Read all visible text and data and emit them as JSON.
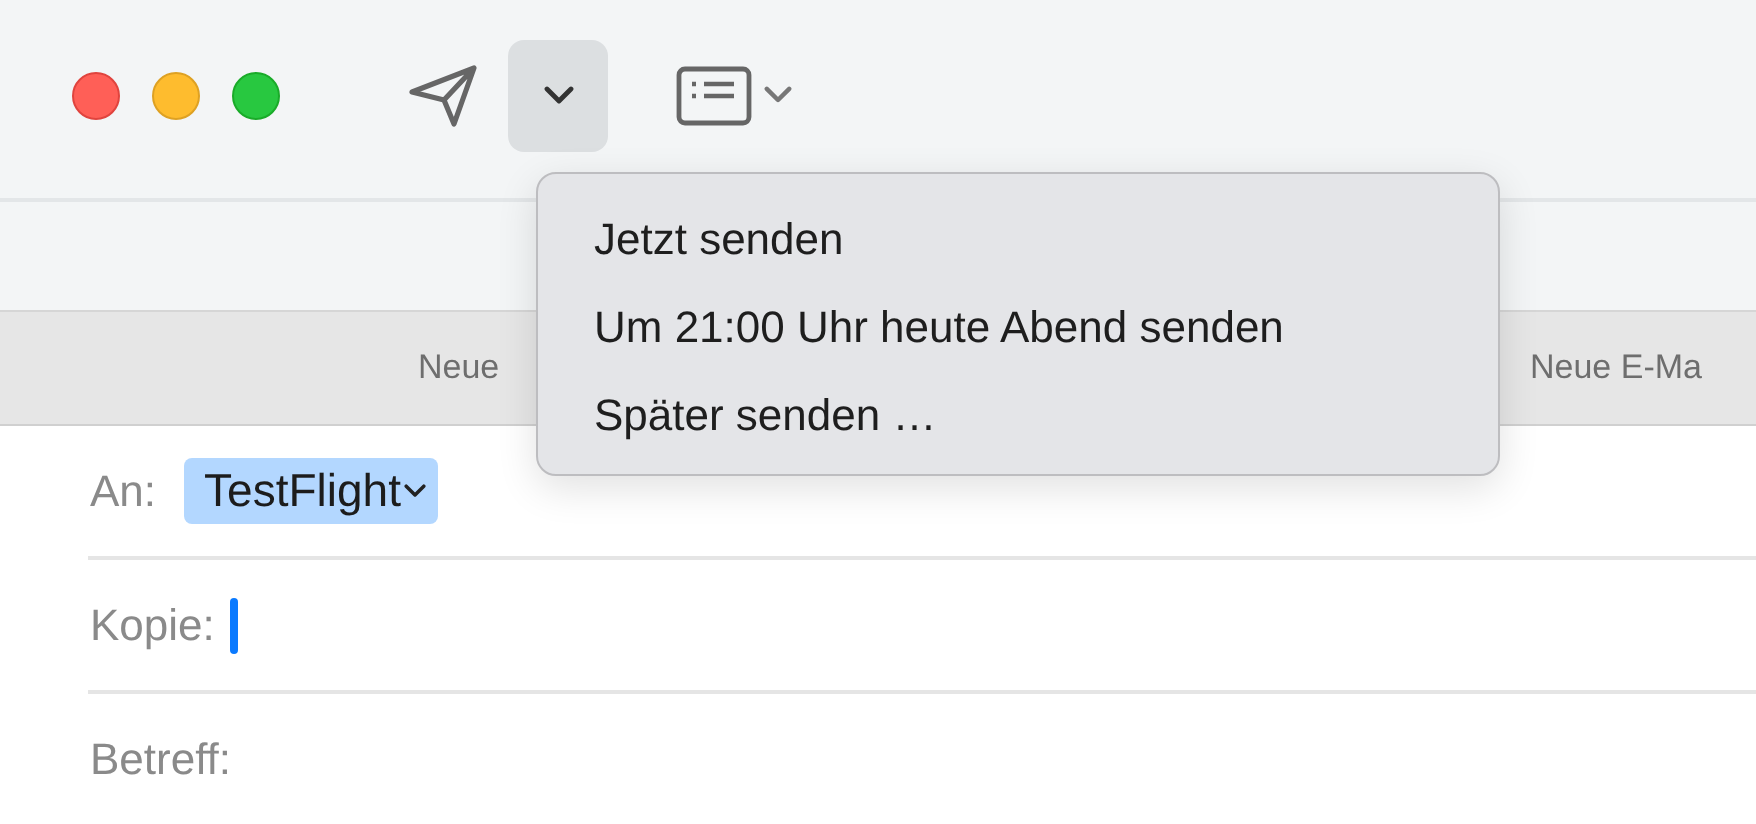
{
  "toolbar": {
    "send_options": {
      "expanded": true
    }
  },
  "tabs": [
    {
      "label": "Neue",
      "selected": false
    },
    {
      "label": "Neue E-Ma",
      "selected": false
    }
  ],
  "send_menu": {
    "items": [
      "Jetzt senden",
      "Um 21:00 Uhr heute Abend senden",
      "Später senden …"
    ]
  },
  "fields": [
    {
      "kind": "recipients",
      "label": "An:",
      "recipients": [
        "TestFlight"
      ]
    },
    {
      "kind": "cursor",
      "label": "Kopie:"
    },
    {
      "kind": "text",
      "label": "Betreff:"
    }
  ]
}
